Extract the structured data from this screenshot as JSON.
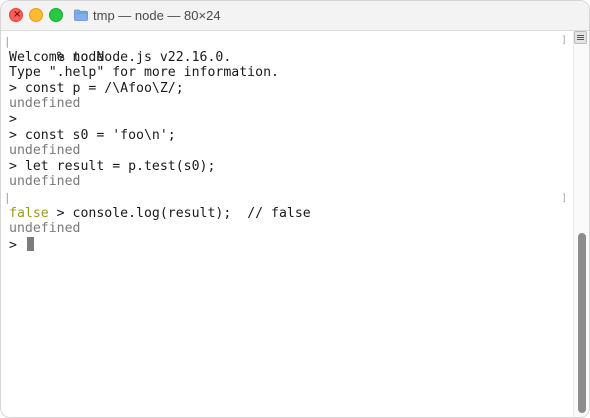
{
  "window": {
    "title": "tmp — node — 80×24",
    "folder_icon": "folder-icon"
  },
  "terminal": {
    "lines": [
      {
        "text": "% node",
        "style": "normal"
      },
      {
        "text": "Welcome to Node.js v22.16.0.",
        "style": "normal"
      },
      {
        "text": "Type \".help\" for more information.",
        "style": "normal"
      },
      {
        "text": "> const p = /\\Afoo\\Z/;",
        "style": "normal"
      },
      {
        "text": "undefined",
        "style": "dim"
      },
      {
        "text": ">",
        "style": "normal"
      },
      {
        "text": "> const s0 = 'foo\\n';",
        "style": "normal"
      },
      {
        "text": "undefined",
        "style": "dim"
      },
      {
        "text": "> let result = p.test(s0);",
        "style": "normal"
      },
      {
        "text": "undefined",
        "style": "dim"
      },
      {
        "text": "> console.log(result);  // false",
        "style": "normal"
      },
      {
        "text": "false",
        "style": "false"
      },
      {
        "text": "undefined",
        "style": "dim"
      },
      {
        "text": "> ",
        "style": "prompt"
      }
    ],
    "colors": {
      "text": "#1a1a1a",
      "dim": "#7a7a7a",
      "boolean_output": "#9a9a22",
      "cursor": "#7c7c7c"
    }
  }
}
